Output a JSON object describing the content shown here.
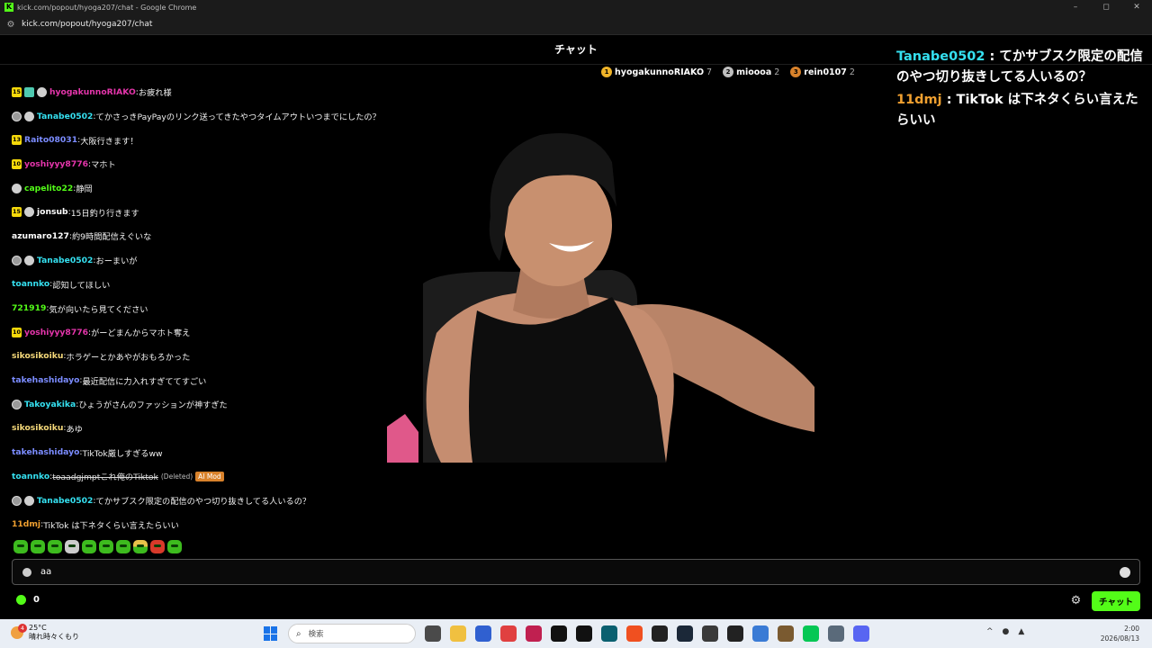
{
  "window": {
    "title": "kick.com/popout/hyoga207/chat - Google Chrome",
    "url": "kick.com/popout/hyoga207/chat",
    "controls": [
      "–",
      "◻",
      "✕"
    ]
  },
  "chat": {
    "header": "チャット",
    "top_gifters": [
      {
        "rank": "1",
        "name": "hyogakunnoRIAKO",
        "count": "7",
        "color": "#f0b429"
      },
      {
        "rank": "2",
        "name": "mioooa",
        "count": "2",
        "color": "#bfbfbf"
      },
      {
        "rank": "3",
        "name": "rein0107",
        "count": "2",
        "color": "#d9822b"
      }
    ],
    "messages": [
      {
        "badges": [
          "15",
          "og",
          "verified"
        ],
        "user": "hyogakunnoRIAKO",
        "color": "#e535ab",
        "text": "お疲れ様"
      },
      {
        "badges": [
          "wolf",
          "verified"
        ],
        "user": "Tanabe0502",
        "color": "#35e0f0",
        "text": "てかさっきPayPayのリンク送ってきたやつタイムアウトいつまでにしたの？"
      },
      {
        "badges": [
          "13"
        ],
        "user": "Raito08031",
        "color": "#7b8cff",
        "text": "大阪行きます！"
      },
      {
        "badges": [
          "10"
        ],
        "user": "yoshiyyy8776",
        "color": "#e535ab",
        "text": "マホト"
      },
      {
        "badges": [
          "verified"
        ],
        "user": "capelito22",
        "color": "#53fc18",
        "text": "静岡"
      },
      {
        "badges": [
          "15",
          "verified"
        ],
        "user": "jonsub",
        "color": "#ffffff",
        "text": "15日釣り行きます"
      },
      {
        "badges": [],
        "user": "azumaro127",
        "color": "#ffffff",
        "text": "約9時間配信えぐいな"
      },
      {
        "badges": [
          "wolf",
          "verified"
        ],
        "user": "Tanabe0502",
        "color": "#35e0f0",
        "text": "おーまいが"
      },
      {
        "badges": [],
        "user": "toannko",
        "color": "#35e0f0",
        "text": "認知してほしい"
      },
      {
        "badges": [],
        "user": "721919",
        "color": "#53fc18",
        "text": "気が向いたら見てください"
      },
      {
        "badges": [
          "10"
        ],
        "user": "yoshiyyy8776",
        "color": "#e535ab",
        "text": "がーどまんからマホト奪え"
      },
      {
        "badges": [],
        "user": "sikosikoiku",
        "color": "#f5d97a",
        "text": "ホラゲーとかあやがおもろかった"
      },
      {
        "badges": [],
        "user": "takehashidayo",
        "color": "#7b8cff",
        "text": "最近配信に力入れすぎててすごい"
      },
      {
        "badges": [
          "wolf"
        ],
        "user": "Takoyakika",
        "color": "#35e0f0",
        "text": "ひょうがさんのファッションが神すぎた"
      },
      {
        "badges": [],
        "user": "sikosikoiku",
        "color": "#f5d97a",
        "text": "あゆ"
      },
      {
        "badges": [],
        "user": "takehashidayo",
        "color": "#7b8cff",
        "text": "TikTok厳しすぎるww"
      },
      {
        "badges": [],
        "user": "toannko",
        "color": "#35e0f0",
        "text": "toaadgjmptこれ俺のTiktok",
        "deleted": "(Deleted)",
        "mod": "AI Mod"
      },
      {
        "badges": [
          "wolf",
          "verified"
        ],
        "user": "Tanabe0502",
        "color": "#35e0f0",
        "text": "てかサブスク限定の配信のやつ切り抜きしてる人いるの？"
      },
      {
        "badges": [],
        "user": "11dmj",
        "color": "#f0a030",
        "text": "TikTok は下ネタくらい言えたらいい"
      }
    ],
    "input_value": "aa",
    "points": "0",
    "send_label": "チャット"
  },
  "overlay": [
    {
      "user": "Tanabe0502",
      "color": "#35e0f0",
      "sep": " : ",
      "text": "てかサブスク限定の配信のやつ切り抜きしてる人いるの？"
    },
    {
      "user": "11dmj",
      "color": "#f0a030",
      "sep": " : ",
      "text": "TikTok は下ネタくらい言えたらいい"
    }
  ],
  "taskbar": {
    "temperature": "25°C",
    "weather": "晴れ時々くもり",
    "weather_badge": "4",
    "search_placeholder": "検索",
    "time": "2:00",
    "date": "2026/08/13",
    "icon_colors": [
      "#4a4a4a",
      "#f0c040",
      "#3060d0",
      "#e04040",
      "#c02050",
      "#111111",
      "#111111",
      "#0a6070",
      "#f05020",
      "#222222",
      "#1b2838",
      "#3a3a3a",
      "#222222",
      "#3a7bd5",
      "#7a5a30",
      "#06c755",
      "#5a6a7a",
      "#5865f2"
    ]
  }
}
